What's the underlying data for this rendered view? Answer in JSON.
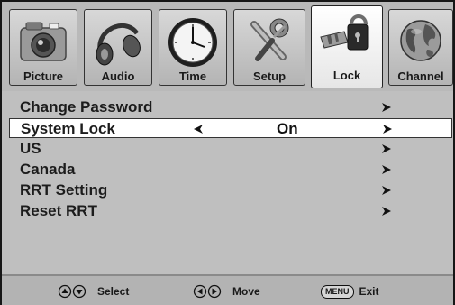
{
  "tabs": [
    {
      "label": "Picture",
      "icon": "camera-icon",
      "active": false
    },
    {
      "label": "Audio",
      "icon": "headphones-icon",
      "active": false
    },
    {
      "label": "Time",
      "icon": "clock-icon",
      "active": false
    },
    {
      "label": "Setup",
      "icon": "tools-icon",
      "active": false
    },
    {
      "label": "Lock",
      "icon": "lock-icon",
      "active": true
    },
    {
      "label": "Channel",
      "icon": "globe-icon",
      "active": false
    }
  ],
  "menu": {
    "items": [
      {
        "label": "Change Password",
        "has_arrow": true
      },
      {
        "label": "System Lock",
        "value": "On",
        "selected": true,
        "has_arrow": true
      },
      {
        "label": "US",
        "has_arrow": true
      },
      {
        "label": "Canada",
        "has_arrow": true
      },
      {
        "label": "RRT Setting",
        "has_arrow": true
      },
      {
        "label": "Reset RRT",
        "has_arrow": true
      }
    ]
  },
  "footer": {
    "select_label": "Select",
    "move_label": "Move",
    "menu_key_label": "MENU",
    "exit_label": "Exit"
  }
}
